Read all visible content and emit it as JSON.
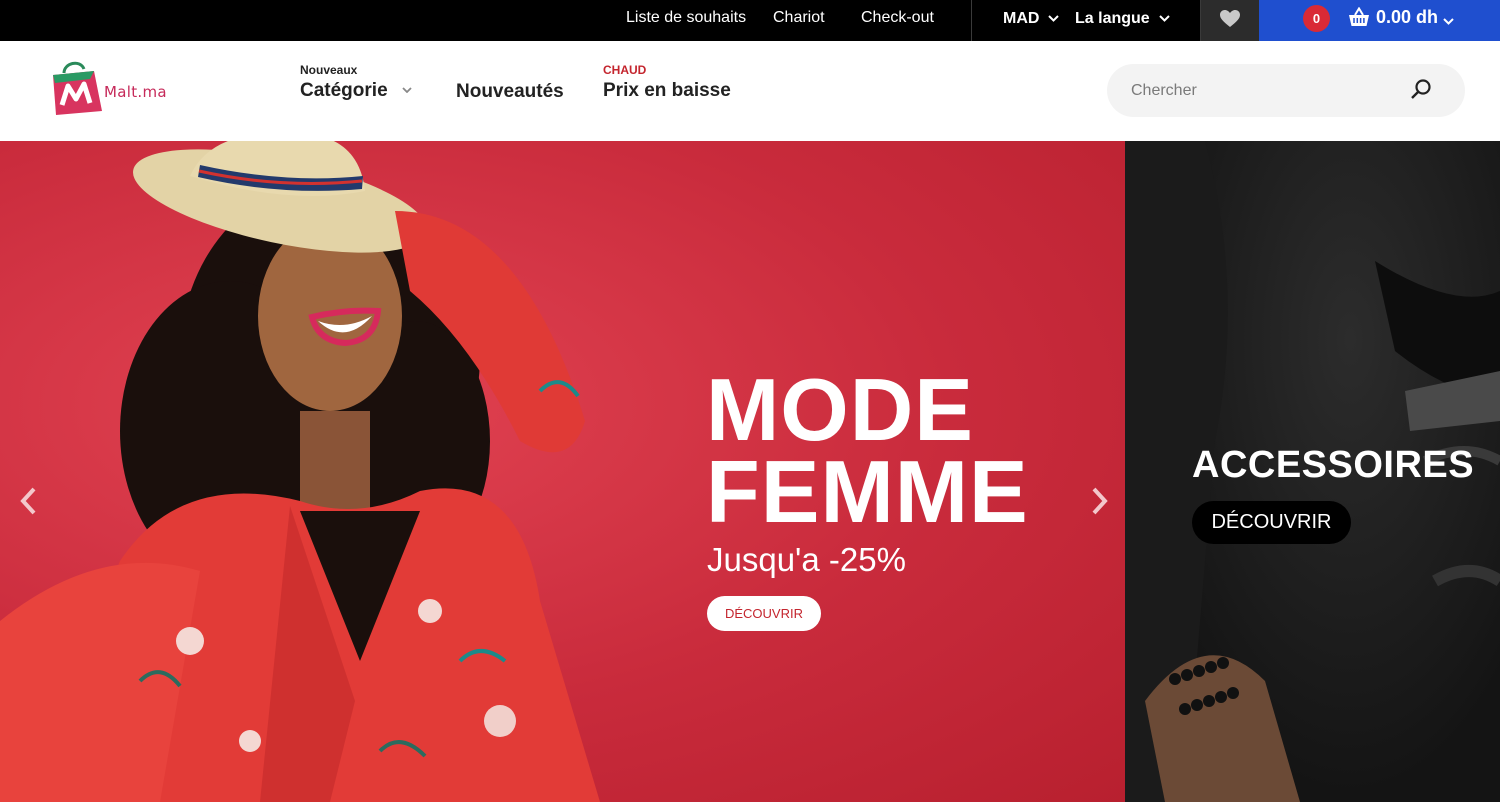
{
  "topbar": {
    "links": [
      "Liste de souhaits",
      "Chariot",
      "Check-out"
    ],
    "currency": "MAD",
    "language": "La langue",
    "cart_count": "0",
    "cart_total": "0.00 dh"
  },
  "header": {
    "logo_text": "Malt.ma",
    "nav": [
      {
        "small": "Nouveaux",
        "label": "Catégorie"
      },
      {
        "small": "",
        "label": "Nouveautés"
      },
      {
        "small": "CHAUD",
        "label": "Prix en baisse"
      }
    ],
    "search_placeholder": "Chercher"
  },
  "hero": {
    "title_line1": "MODE",
    "title_line2": "FEMME",
    "subtitle": "Jusqu'a -25%",
    "button": "DÉCOUVRIR"
  },
  "side_banner": {
    "title": "ACCESSOIRES",
    "button": "DÉCOUVRIR"
  },
  "colors": {
    "cart_bg": "#1f4fcf",
    "badge": "#d92a36",
    "hero_bg": "#c92b3c",
    "hot_label": "#c4252e"
  },
  "icons": [
    "heart-icon",
    "basket-icon",
    "chevron-down-icon",
    "search-icon",
    "chevron-left-icon",
    "chevron-right-icon"
  ]
}
